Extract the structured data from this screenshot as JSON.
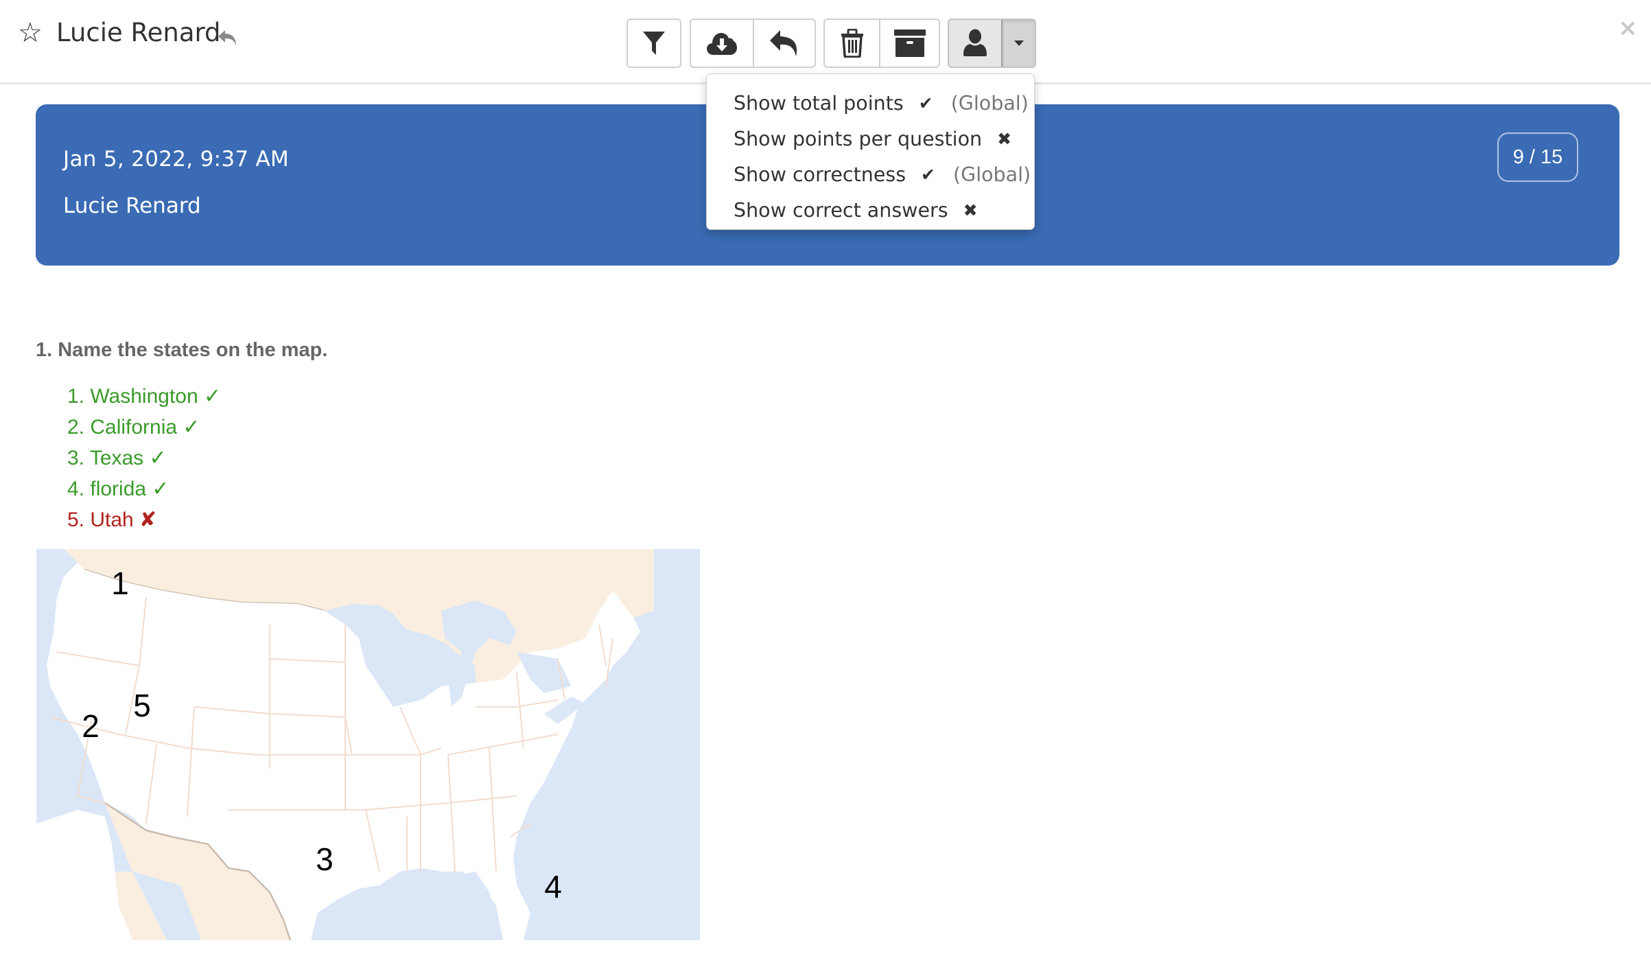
{
  "header": {
    "title": "Lucie Renard",
    "star_icon": "☆",
    "close_icon": "×"
  },
  "toolbar": {
    "buttons": [
      {
        "name": "filter",
        "icon": "filter-icon"
      },
      {
        "name": "download",
        "icon": "cloud-download-icon"
      },
      {
        "name": "reply",
        "icon": "reply-icon"
      },
      {
        "name": "delete",
        "icon": "trash-icon"
      },
      {
        "name": "archive",
        "icon": "archive-icon"
      },
      {
        "name": "user",
        "icon": "user-icon"
      },
      {
        "name": "user-menu-toggle",
        "icon": "caret-down-icon"
      }
    ]
  },
  "dropdown": {
    "items": [
      {
        "label": "Show total points",
        "mark": "✔",
        "state": "on",
        "scope": "(Global)"
      },
      {
        "label": "Show points per question",
        "mark": "✖",
        "state": "off",
        "scope": ""
      },
      {
        "label": "Show correctness",
        "mark": "✔",
        "state": "on",
        "scope": "(Global)"
      },
      {
        "label": "Show correct answers",
        "mark": "✖",
        "state": "off",
        "scope": ""
      }
    ]
  },
  "banner": {
    "date": "Jan 5, 2022, 9:37 AM",
    "name": "Lucie Renard",
    "score": "9 / 15",
    "color": "#3a6bb4"
  },
  "question": {
    "text": "1. Name the states on the map.",
    "answers": [
      {
        "text": "1. Washington ✓",
        "correct": true
      },
      {
        "text": "2. California ✓",
        "correct": true
      },
      {
        "text": "3. Texas ✓",
        "correct": true
      },
      {
        "text": "4. florida ✓",
        "correct": true
      },
      {
        "text": "5. Utah ✘",
        "correct": false
      }
    ]
  },
  "map": {
    "labels": [
      "1",
      "2",
      "3",
      "4",
      "5"
    ],
    "colors": {
      "water": "#dbe7f7",
      "foreign_land": "#faeee0",
      "us_land": "#ffffff",
      "state_border": "#f2dccd",
      "country_border": "#cbbcae"
    }
  },
  "colors": {
    "correct": "#3a9a2a",
    "incorrect": "#b0231e"
  }
}
